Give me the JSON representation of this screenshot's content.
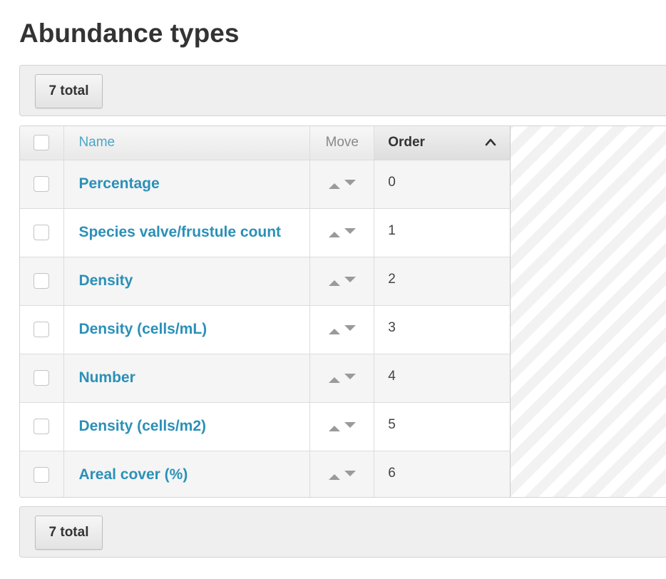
{
  "page": {
    "title": "Abundance types"
  },
  "toolbar_top": {
    "total_label": "7 total"
  },
  "toolbar_bottom": {
    "total_label": "7 total"
  },
  "table": {
    "columns": {
      "name": "Name",
      "move": "Move",
      "order": "Order"
    },
    "sort": {
      "column": "Order",
      "direction": "ascending",
      "icon": "chevron-up-icon"
    },
    "rows": [
      {
        "name": "Percentage",
        "order": "0"
      },
      {
        "name": "Species valve/frustule count",
        "order": "1"
      },
      {
        "name": "Density",
        "order": "2"
      },
      {
        "name": "Density (cells/mL)",
        "order": "3"
      },
      {
        "name": "Number",
        "order": "4"
      },
      {
        "name": "Density (cells/m2)",
        "order": "5"
      },
      {
        "name": "Areal cover (%)",
        "order": "6"
      }
    ]
  },
  "colors": {
    "link": "#2b90b8",
    "header_link": "#4aa6c9",
    "toolbar_bg": "#efefef"
  }
}
